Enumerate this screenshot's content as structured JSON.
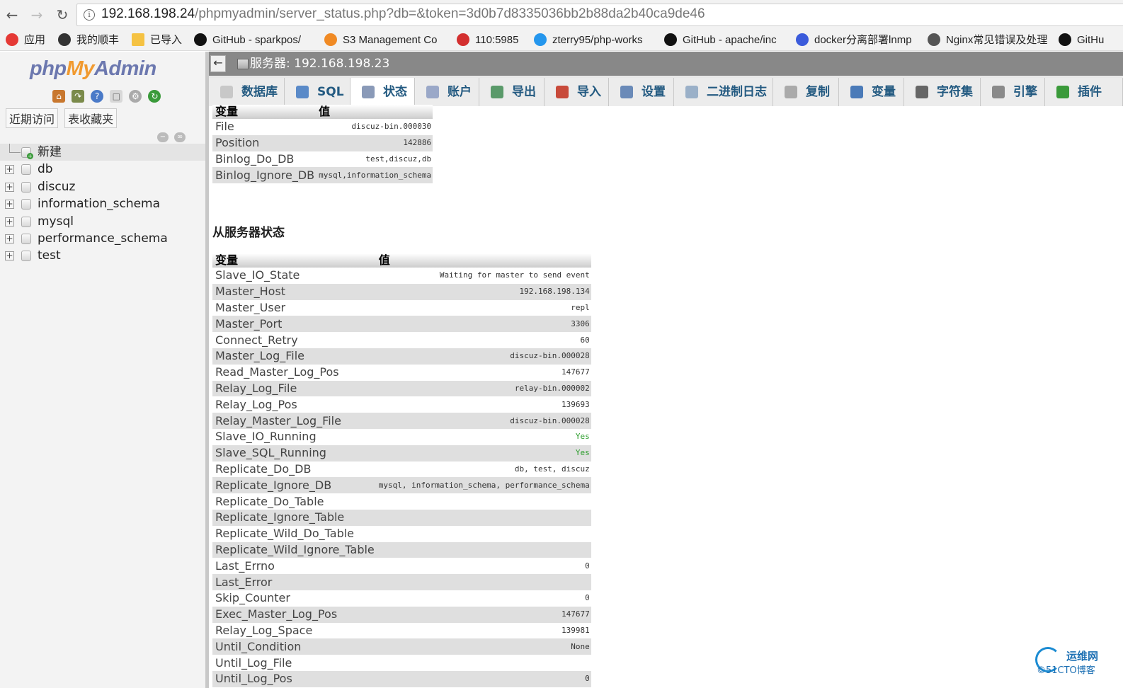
{
  "browser": {
    "url_host": "192.168.198.24",
    "url_path": "/phpmyadmin/server_status.php?db=&token=3d0b7d8335036bb2b88da2b40ca9de46",
    "bookmarks": [
      {
        "label": "应用",
        "icon": "apps-grid-icon",
        "color": "#e53935"
      },
      {
        "label": "我的顺丰",
        "icon": "sf-express-icon",
        "color": "#333333"
      },
      {
        "label": "已导入",
        "icon": "folder-icon",
        "color": "#f5c242"
      },
      {
        "label": "GitHub - sparkpos/",
        "icon": "github-icon",
        "color": "#111111"
      },
      {
        "label": "S3 Management Co",
        "icon": "aws-cube-icon",
        "color": "#f08a24"
      },
      {
        "label": "110:5985",
        "icon": "server-icon",
        "color": "#d32f2f"
      },
      {
        "label": "zterry95/php-works",
        "icon": "docker-whale-icon",
        "color": "#2496ed"
      },
      {
        "label": "GitHub - apache/inc",
        "icon": "github-icon",
        "color": "#111111"
      },
      {
        "label": "docker分离部署lnmp",
        "icon": "blog-icon",
        "color": "#3b5bdb"
      },
      {
        "label": "Nginx常见错误及处理",
        "icon": "pen-icon",
        "color": "#555555"
      },
      {
        "label": "GitHu",
        "icon": "github-icon",
        "color": "#111111"
      }
    ]
  },
  "nav": {
    "logo": {
      "php": "php",
      "my": "My",
      "admin": "Admin"
    },
    "links": [
      "近期访问",
      "表收藏夹"
    ],
    "databases": [
      "新建",
      "db",
      "discuz",
      "information_schema",
      "mysql",
      "performance_schema",
      "test"
    ]
  },
  "header": {
    "server_title": "服务器: 192.168.198.23"
  },
  "tabs": [
    {
      "label": "数据库",
      "icon": "database-icon",
      "active": false
    },
    {
      "label": "SQL",
      "icon": "sql-icon",
      "active": false
    },
    {
      "label": "状态",
      "icon": "status-chart-icon",
      "active": true
    },
    {
      "label": "账户",
      "icon": "accounts-icon",
      "active": false
    },
    {
      "label": "导出",
      "icon": "export-icon",
      "active": false
    },
    {
      "label": "导入",
      "icon": "import-icon",
      "active": false
    },
    {
      "label": "设置",
      "icon": "wrench-icon",
      "active": false
    },
    {
      "label": "二进制日志",
      "icon": "binlog-icon",
      "active": false
    },
    {
      "label": "复制",
      "icon": "replication-icon",
      "active": false
    },
    {
      "label": "变量",
      "icon": "variables-icon",
      "active": false
    },
    {
      "label": "字符集",
      "icon": "charset-icon",
      "active": false
    },
    {
      "label": "引擎",
      "icon": "engine-icon",
      "active": false
    },
    {
      "label": "插件",
      "icon": "puzzle-icon",
      "active": false
    }
  ],
  "master_status": {
    "headers": [
      "变量",
      "值"
    ],
    "rows": [
      {
        "name": "File",
        "value": "discuz-bin.000030"
      },
      {
        "name": "Position",
        "value": "142886"
      },
      {
        "name": "Binlog_Do_DB",
        "value": "test,discuz,db"
      },
      {
        "name": "Binlog_Ignore_DB",
        "value": "mysql,information_schema"
      }
    ]
  },
  "slave_status": {
    "heading": "从服务器状态",
    "headers": [
      "变量",
      "值"
    ],
    "rows": [
      {
        "name": "Slave_IO_State",
        "value": "Waiting for master to send event"
      },
      {
        "name": "Master_Host",
        "value": "192.168.198.134"
      },
      {
        "name": "Master_User",
        "value": "repl"
      },
      {
        "name": "Master_Port",
        "value": "3306"
      },
      {
        "name": "Connect_Retry",
        "value": "60"
      },
      {
        "name": "Master_Log_File",
        "value": "discuz-bin.000028"
      },
      {
        "name": "Read_Master_Log_Pos",
        "value": "147677"
      },
      {
        "name": "Relay_Log_File",
        "value": "relay-bin.000002"
      },
      {
        "name": "Relay_Log_Pos",
        "value": "139693"
      },
      {
        "name": "Relay_Master_Log_File",
        "value": "discuz-bin.000028"
      },
      {
        "name": "Slave_IO_Running",
        "value": "Yes",
        "ok": true
      },
      {
        "name": "Slave_SQL_Running",
        "value": "Yes",
        "ok": true
      },
      {
        "name": "Replicate_Do_DB",
        "value": "db, test, discuz"
      },
      {
        "name": "Replicate_Ignore_DB",
        "value": "mysql, information_schema, performance_schema"
      },
      {
        "name": "Replicate_Do_Table",
        "value": ""
      },
      {
        "name": "Replicate_Ignore_Table",
        "value": ""
      },
      {
        "name": "Replicate_Wild_Do_Table",
        "value": ""
      },
      {
        "name": "Replicate_Wild_Ignore_Table",
        "value": ""
      },
      {
        "name": "Last_Errno",
        "value": "0"
      },
      {
        "name": "Last_Error",
        "value": ""
      },
      {
        "name": "Skip_Counter",
        "value": "0"
      },
      {
        "name": "Exec_Master_Log_Pos",
        "value": "147677"
      },
      {
        "name": "Relay_Log_Space",
        "value": "139981"
      },
      {
        "name": "Until_Condition",
        "value": "None"
      },
      {
        "name": "Until_Log_File",
        "value": ""
      },
      {
        "name": "Until_Log_Pos",
        "value": "0"
      }
    ]
  },
  "watermark": {
    "text": "运维网",
    "sub": "©51CTO博客"
  }
}
